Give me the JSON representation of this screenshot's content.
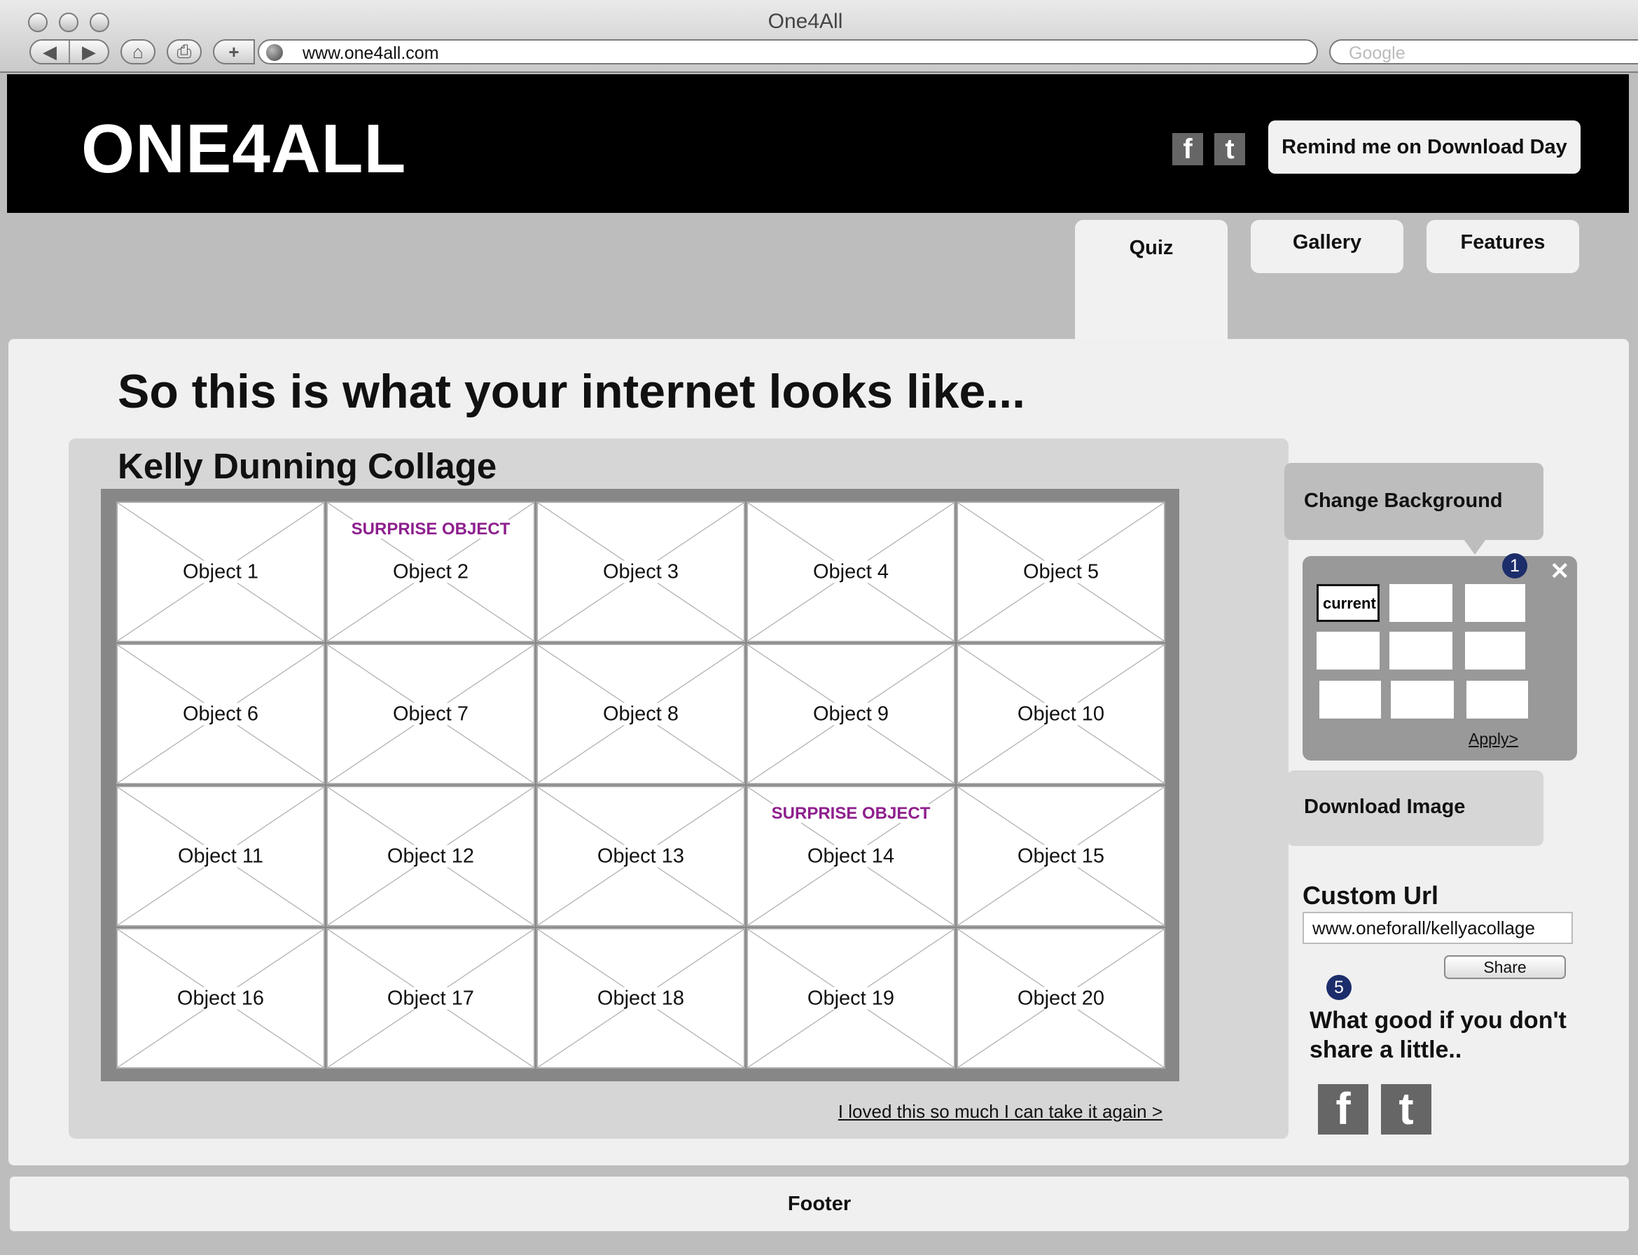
{
  "browser": {
    "window_title": "One4All",
    "url": "www.one4all.com",
    "search_placeholder": "Google",
    "icons": [
      "back-icon",
      "forward-icon",
      "home-icon",
      "print-icon",
      "add-bookmark-icon",
      "globe-icon"
    ]
  },
  "header": {
    "logo": "ONE4ALL",
    "facebook_glyph": "f",
    "twitter_glyph": "t",
    "remind_label": "Remind me on Download Day"
  },
  "tabs": [
    {
      "label": "Quiz",
      "active": true
    },
    {
      "label": "Gallery",
      "active": false
    },
    {
      "label": "Features",
      "active": false
    }
  ],
  "main": {
    "headline": "So this is what your internet looks like...",
    "collage_title": "Kelly Dunning Collage",
    "objects": [
      {
        "label": "Object 1",
        "surprise": ""
      },
      {
        "label": "Object 2",
        "surprise": "SURPRISE OBJECT"
      },
      {
        "label": "Object 3",
        "surprise": ""
      },
      {
        "label": "Object 4",
        "surprise": ""
      },
      {
        "label": "Object 5",
        "surprise": ""
      },
      {
        "label": "Object 6",
        "surprise": ""
      },
      {
        "label": "Object 7",
        "surprise": ""
      },
      {
        "label": "Object 8",
        "surprise": ""
      },
      {
        "label": "Object 9",
        "surprise": ""
      },
      {
        "label": "Object 10",
        "surprise": ""
      },
      {
        "label": "Object 11",
        "surprise": ""
      },
      {
        "label": "Object 12",
        "surprise": ""
      },
      {
        "label": "Object 13",
        "surprise": ""
      },
      {
        "label": "Object 14",
        "surprise": "SURPRISE OBJECT"
      },
      {
        "label": "Object 15",
        "surprise": ""
      },
      {
        "label": "Object 16",
        "surprise": ""
      },
      {
        "label": "Object 17",
        "surprise": ""
      },
      {
        "label": "Object 18",
        "surprise": ""
      },
      {
        "label": "Object 19",
        "surprise": ""
      },
      {
        "label": "Object 20",
        "surprise": ""
      }
    ],
    "retake_link": "I loved this so much I can take it again >"
  },
  "sidebar": {
    "change_background_label": "Change Background",
    "background_panel": {
      "badge": "1",
      "close_glyph": "✕",
      "current_label": "current",
      "apply_label": "Apply>"
    },
    "download_label": "Download Image",
    "custom_url_label": "Custom Url",
    "custom_url_value": "www.oneforall/kellyacollage",
    "share_label": "Share",
    "share_badge": "5",
    "share_prompt": "What good if you don't share a little..",
    "facebook_glyph": "f",
    "twitter_glyph": "t"
  },
  "footer": {
    "label": "Footer"
  },
  "colors": {
    "surprise": "#8e1f8e",
    "badge": "#1c2d6b",
    "header_bg": "#000000"
  }
}
